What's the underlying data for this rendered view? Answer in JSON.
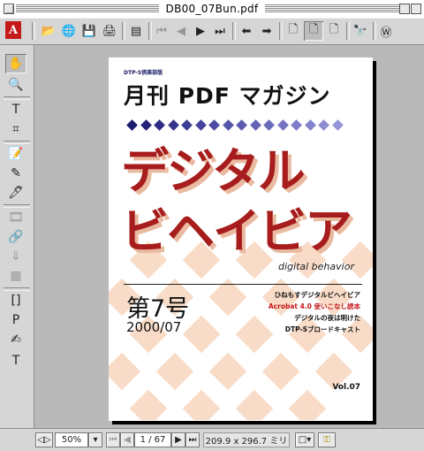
{
  "window": {
    "title": "DB00_07Bun.pdf"
  },
  "toolbar": {
    "buttons": [
      "open-icon",
      "acquire-icon",
      "save-icon",
      "print-icon",
      "thumbnails-icon",
      "first-page-icon",
      "prev-page-icon",
      "next-page-icon",
      "last-page-icon",
      "go-back-icon",
      "go-forward-icon",
      "actual-size-icon",
      "fit-page-icon",
      "fit-width-icon",
      "find-icon",
      "web-link-icon"
    ]
  },
  "tools": [
    "hand-tool",
    "zoom-tool",
    "text-select-tool",
    "crop-tool",
    "note-tool",
    "pencil-tool",
    "highlight-tool",
    "movie-tool",
    "link-tool",
    "article-tool",
    "form-tool",
    "column-select-tool",
    "graphics-select-tool",
    "stamp-tool",
    "touchup-text-tool"
  ],
  "cover": {
    "series_label": "DTP-S倶楽部版",
    "magazine_title": "月刊 PDF マガジン",
    "big_title_line1": "デジタル",
    "big_title_line2": "ビヘイビア",
    "subtitle": "digital behavior",
    "issue_number": "第7号",
    "issue_date": "2000/07",
    "headlines": [
      {
        "text": "ひねもすデジタルビヘイビア",
        "color": "#111111"
      },
      {
        "text": "Acrobat 4.0 使いこなし読本",
        "color": "#c4161c"
      },
      {
        "text": "デジタルの夜は明けた",
        "color": "#111111"
      },
      {
        "text": "DTP-Sブロードキャスト",
        "color": "#111111"
      }
    ],
    "volume": "Vol.07",
    "colors": {
      "title_red": "#a71c1c",
      "diamond_dark": "#1c1c6e",
      "diamond_mid": "#3a3a8a",
      "checker": "#f8dcc7"
    }
  },
  "statusbar": {
    "zoom": "50%",
    "page": "1 / 67",
    "page_size": "209.9 x 296.7 ミリ"
  }
}
